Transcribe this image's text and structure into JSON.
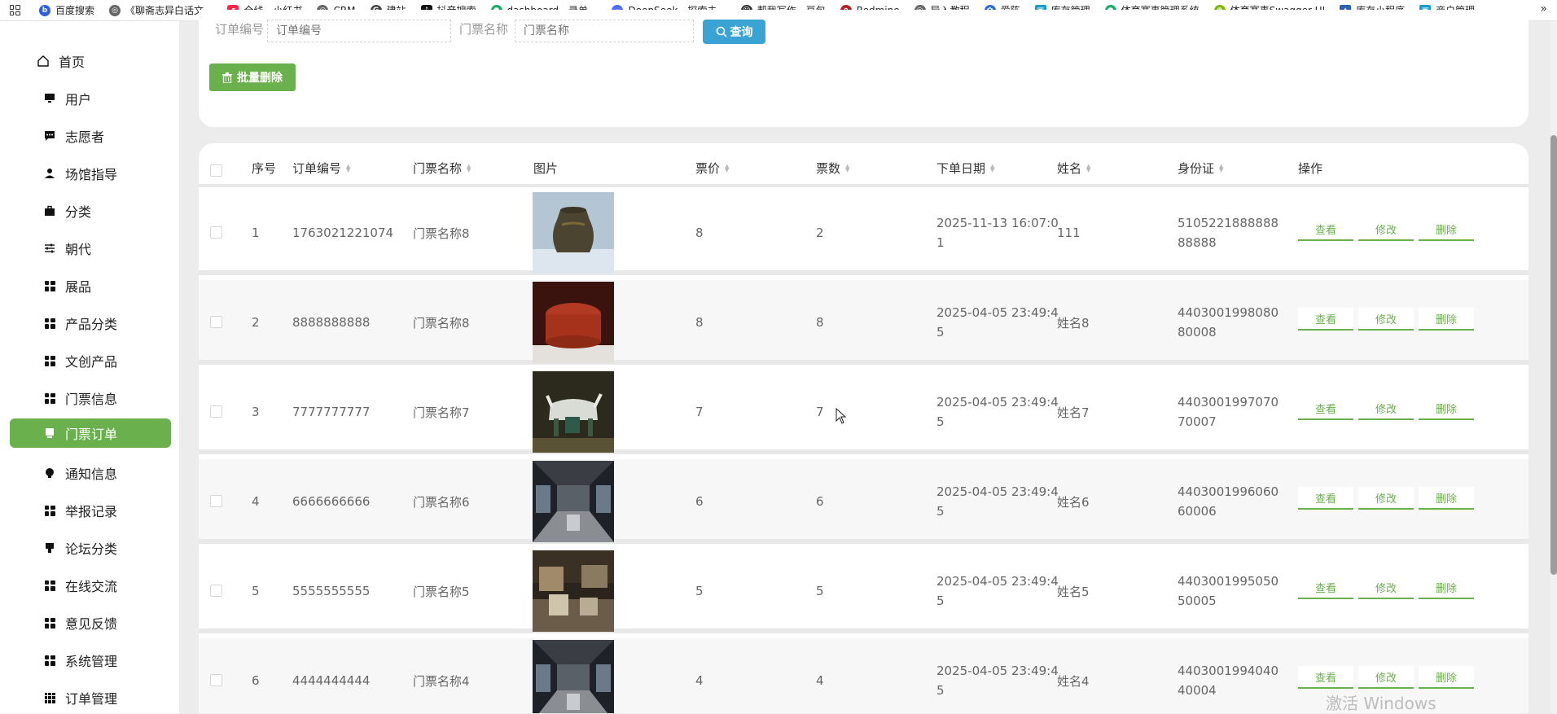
{
  "bookmarks": [
    {
      "label": "百度搜索",
      "color": "#3060e0"
    },
    {
      "label": "《聊斋志异白话文...",
      "color": "#555555"
    },
    {
      "label": "全线 - 小红书",
      "color": "#ff2442"
    },
    {
      "label": "CRM",
      "color": "#555555"
    },
    {
      "label": "建站",
      "color": "#444444"
    },
    {
      "label": "抖音搜索",
      "color": "#111111"
    },
    {
      "label": "dashboard - 录单...",
      "color": "#1aaa6a"
    },
    {
      "label": "DeepSeek - 探索未...",
      "color": "#4d6bfe"
    },
    {
      "label": "帮我写作 - 豆包",
      "color": "#333333"
    },
    {
      "label": "Redmine",
      "color": "#b32024"
    },
    {
      "label": "导入教程",
      "color": "#555555"
    },
    {
      "label": "爱阵",
      "color": "#2b6bd6"
    },
    {
      "label": "库存管理",
      "color": "#1a9ec9"
    },
    {
      "label": "体育赛事管理系统",
      "color": "#1aaa6a"
    },
    {
      "label": "体育赛事Swagger UI",
      "color": "#7ab800"
    },
    {
      "label": "库存小程序",
      "color": "#2b5fb4"
    },
    {
      "label": "商户管理",
      "color": "#1a9ec9"
    }
  ],
  "bookmarks_more": "»",
  "sidebar": {
    "home": "首页",
    "items": [
      {
        "label": "用户",
        "icon": "monitor-icon"
      },
      {
        "label": "志愿者",
        "icon": "chat-icon"
      },
      {
        "label": "场馆指导",
        "icon": "person-icon"
      },
      {
        "label": "分类",
        "icon": "briefcase-icon"
      },
      {
        "label": "朝代",
        "icon": "sliders-icon"
      },
      {
        "label": "展品",
        "icon": "grid-icon"
      },
      {
        "label": "产品分类",
        "icon": "grid-icon"
      },
      {
        "label": "文创产品",
        "icon": "grid-icon"
      },
      {
        "label": "门票信息",
        "icon": "grid-icon"
      },
      {
        "label": "门票订单",
        "icon": "tablet-icon",
        "active": true
      },
      {
        "label": "通知信息",
        "icon": "bulb-icon"
      },
      {
        "label": "举报记录",
        "icon": "grid-icon"
      },
      {
        "label": "论坛分类",
        "icon": "trophy-icon"
      },
      {
        "label": "在线交流",
        "icon": "grid-icon"
      },
      {
        "label": "意见反馈",
        "icon": "grid-icon"
      },
      {
        "label": "系统管理",
        "icon": "grid-icon"
      },
      {
        "label": "订单管理",
        "icon": "apps-icon"
      }
    ]
  },
  "search": {
    "order_no_label": "订单编号",
    "order_no_placeholder": "订单编号",
    "ticket_name_label": "门票名称",
    "ticket_name_placeholder": "门票名称",
    "query_button": "查询",
    "batch_delete_button": "批量删除"
  },
  "table": {
    "headers": {
      "index": "序号",
      "order_no": "订单编号",
      "ticket_name": "门票名称",
      "image": "图片",
      "price": "票价",
      "count": "票数",
      "order_date": "下单日期",
      "name": "姓名",
      "id_card": "身份证",
      "actions": "操作"
    },
    "actions": {
      "view": "查看",
      "edit": "修改",
      "delete": "删除"
    },
    "rows": [
      {
        "index": "1",
        "order_no": "1763021221074",
        "ticket_name": "门票名称8",
        "image": "bronze-vase",
        "price": "8",
        "count": "2",
        "order_date": "2025-11-13 16:07:01",
        "name": "111",
        "id_card": "510522188888888888"
      },
      {
        "index": "2",
        "order_no": "8888888888",
        "ticket_name": "门票名称8",
        "image": "red-lacquer-box",
        "price": "8",
        "count": "8",
        "order_date": "2025-04-05 23:49:45",
        "name": "姓名8",
        "id_card": "440300199808080008"
      },
      {
        "index": "3",
        "order_no": "7777777777",
        "ticket_name": "门票名称7",
        "image": "ox-figure",
        "price": "7",
        "count": "7",
        "order_date": "2025-04-05 23:49:45",
        "name": "姓名7",
        "id_card": "440300199707070007"
      },
      {
        "index": "4",
        "order_no": "6666666666",
        "ticket_name": "门票名称6",
        "image": "gallery-hall",
        "price": "6",
        "count": "6",
        "order_date": "2025-04-05 23:49:45",
        "name": "姓名6",
        "id_card": "440300199606060006"
      },
      {
        "index": "5",
        "order_no": "5555555555",
        "ticket_name": "门票名称5",
        "image": "gallery-room",
        "price": "5",
        "count": "5",
        "order_date": "2025-04-05 23:49:45",
        "name": "姓名5",
        "id_card": "440300199505050005"
      },
      {
        "index": "6",
        "order_no": "4444444444",
        "ticket_name": "门票名称4",
        "image": "gallery-hall",
        "price": "4",
        "count": "4",
        "order_date": "2025-04-05 23:49:45",
        "name": "姓名4",
        "id_card": "440300199404040004"
      }
    ]
  },
  "watermark": "激活 Windows",
  "colors": {
    "accent": "#6ab04c",
    "query": "#3aa3d4"
  }
}
